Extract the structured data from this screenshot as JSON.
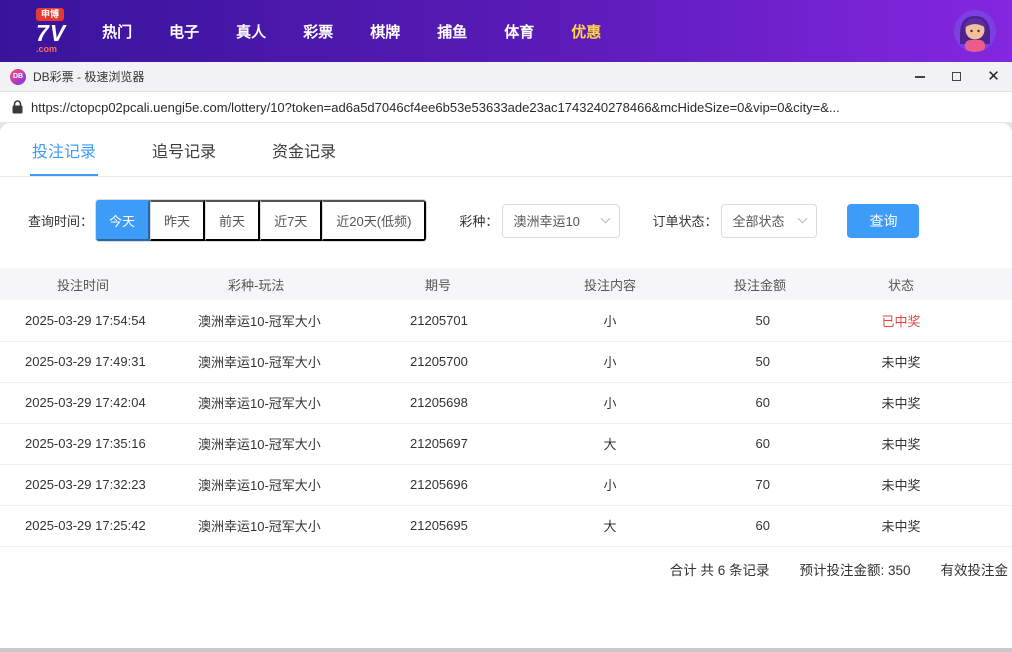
{
  "topbar": {
    "logo": {
      "badge": "申博",
      "main": "7V",
      "sub": ".com"
    },
    "nav": [
      {
        "key": "hot",
        "label": "热门",
        "active": false
      },
      {
        "key": "slots",
        "label": "电子",
        "active": false
      },
      {
        "key": "live",
        "label": "真人",
        "active": false
      },
      {
        "key": "lottery",
        "label": "彩票",
        "active": false
      },
      {
        "key": "chess",
        "label": "棋牌",
        "active": false
      },
      {
        "key": "fishing",
        "label": "捕鱼",
        "active": false
      },
      {
        "key": "sports",
        "label": "体育",
        "active": false
      },
      {
        "key": "promo",
        "label": "优惠",
        "active": true
      }
    ]
  },
  "window": {
    "title": "DB彩票 - 极速浏览器",
    "app_icon": "DB"
  },
  "addressbar": {
    "url": "https://ctopcp02pcali.uengi5e.com/lottery/10?token=ad6a5d7046cf4ee6b53e53633ade23ac1743240278466&mcHideSize=0&vip=0&city=&..."
  },
  "tabs": [
    {
      "key": "bet-records",
      "label": "投注记录",
      "active": true
    },
    {
      "key": "chase-records",
      "label": "追号记录",
      "active": false
    },
    {
      "key": "fund-records",
      "label": "资金记录",
      "active": false
    }
  ],
  "filters": {
    "time_label": "查询时间：",
    "time_options": [
      {
        "key": "today",
        "label": "今天",
        "active": true
      },
      {
        "key": "yesterday",
        "label": "昨天",
        "active": false
      },
      {
        "key": "day-before",
        "label": "前天",
        "active": false
      },
      {
        "key": "last7",
        "label": "近7天",
        "active": false
      },
      {
        "key": "last20",
        "label": "近20天(低频)",
        "active": false
      }
    ],
    "lottery_label": "彩种：",
    "lottery_value": "澳洲幸运10",
    "status_label": "订单状态：",
    "status_value": "全部状态",
    "search_label": "查询"
  },
  "table": {
    "headers": [
      "投注时间",
      "彩种-玩法",
      "期号",
      "投注内容",
      "投注金额",
      "状态"
    ],
    "rows": [
      {
        "time": "2025-03-29 17:54:54",
        "game": "澳洲幸运10-冠军大小",
        "issue": "21205701",
        "content": "小",
        "amount": "50",
        "status": "已中奖",
        "win": true
      },
      {
        "time": "2025-03-29 17:49:31",
        "game": "澳洲幸运10-冠军大小",
        "issue": "21205700",
        "content": "小",
        "amount": "50",
        "status": "未中奖",
        "win": false
      },
      {
        "time": "2025-03-29 17:42:04",
        "game": "澳洲幸运10-冠军大小",
        "issue": "21205698",
        "content": "小",
        "amount": "60",
        "status": "未中奖",
        "win": false
      },
      {
        "time": "2025-03-29 17:35:16",
        "game": "澳洲幸运10-冠军大小",
        "issue": "21205697",
        "content": "大",
        "amount": "60",
        "status": "未中奖",
        "win": false
      },
      {
        "time": "2025-03-29 17:32:23",
        "game": "澳洲幸运10-冠军大小",
        "issue": "21205696",
        "content": "小",
        "amount": "70",
        "status": "未中奖",
        "win": false
      },
      {
        "time": "2025-03-29 17:25:42",
        "game": "澳洲幸运10-冠军大小",
        "issue": "21205695",
        "content": "大",
        "amount": "60",
        "status": "未中奖",
        "win": false
      }
    ]
  },
  "summary": {
    "total": "合计 共 6 条记录",
    "expected": "预计投注金额: 350",
    "valid": "有效投注金"
  },
  "colors": {
    "accent_blue": "#3d9cf7",
    "win_red": "#e64542",
    "nav_highlight": "#ffd448",
    "header_gradient_start": "#38149b",
    "header_gradient_end": "#8427e0"
  }
}
